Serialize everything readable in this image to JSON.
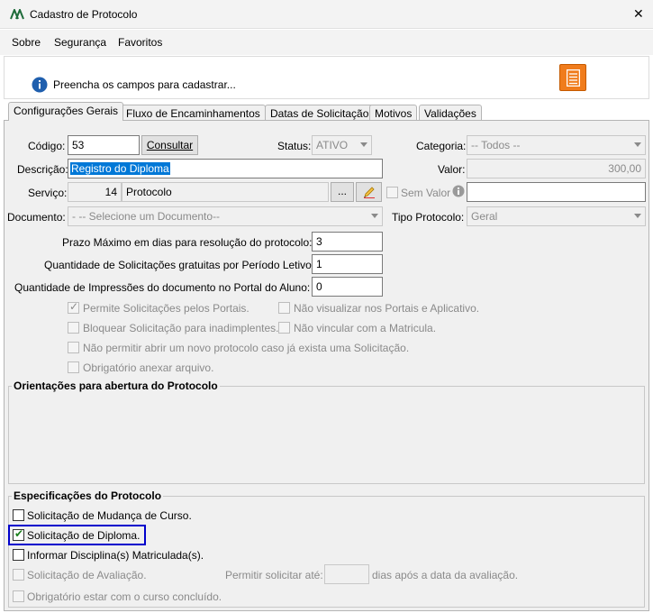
{
  "window": {
    "title": "Cadastro de Protocolo",
    "close_glyph": "✕"
  },
  "menu": {
    "sobre": "Sobre",
    "seguranca": "Segurança",
    "favoritos": "Favoritos"
  },
  "info": {
    "message": "Preencha os campos para cadastrar..."
  },
  "tabs": [
    "Configurações Gerais",
    "Fluxo de Encaminhamentos",
    "Datas de Solicitação",
    "Motivos",
    "Validações"
  ],
  "form": {
    "codigo_label": "Código:",
    "codigo_value": "53",
    "consultar": "Consultar",
    "status_label": "Status:",
    "status_value": "ATIVO",
    "categoria_label": "Categoria:",
    "categoria_value": "-- Todos --",
    "descricao_label": "Descrição:",
    "descricao_value": "Registro do Diploma",
    "valor_label": "Valor:",
    "valor_value": "300,00",
    "servico_label": "Serviço:",
    "servico_code": "14",
    "servico_name": "Protocolo",
    "ellipsis": "...",
    "sem_valor": "Sem Valor",
    "documento_label": "Documento:",
    "documento_value": "- -- Selecione um Documento--",
    "tipo_label": "Tipo Protocolo:",
    "tipo_value": "Geral",
    "prazo_label": "Prazo Máximo em dias para resolução do protocolo:",
    "prazo_value": "3",
    "qtd_sol_label": "Quantidade de Solicitações gratuitas por Período Letivo:",
    "qtd_sol_value": "1",
    "qtd_imp_label": "Quantidade de Impressões do documento no Portal do Aluno:",
    "qtd_imp_value": "0"
  },
  "options": {
    "permite": "Permite Solicitações pelos Portais.",
    "nao_visualizar": "Não visualizar nos Portais e Aplicativo.",
    "bloquear": "Bloquear Solicitação para inadimplentes.",
    "nao_vincular": "Não vincular com a Matricula.",
    "nao_permitir": "Não permitir abrir um novo protocolo caso já exista uma Solicitação.",
    "obrigatorio_anexar": "Obrigatório anexar arquivo."
  },
  "orientacoes": {
    "title": "Orientações para abertura do Protocolo"
  },
  "especificacoes": {
    "title": "Especificações do Protocolo",
    "mudanca": "Solicitação de Mudança de Curso.",
    "diploma": "Solicitação de Diploma.",
    "disciplinas": "Informar Disciplina(s) Matriculada(s).",
    "avaliacao": "Solicitação de Avaliação.",
    "permitir_ate": "Permitir solicitar até:",
    "dias_apos": "dias após a data da avaliação.",
    "curso_concluido": "Obrigatório estar com o curso concluído."
  },
  "colors": {
    "highlight": "#0078d7",
    "focus_box": "#0000cc",
    "doc_icon": "#f07c1c"
  }
}
